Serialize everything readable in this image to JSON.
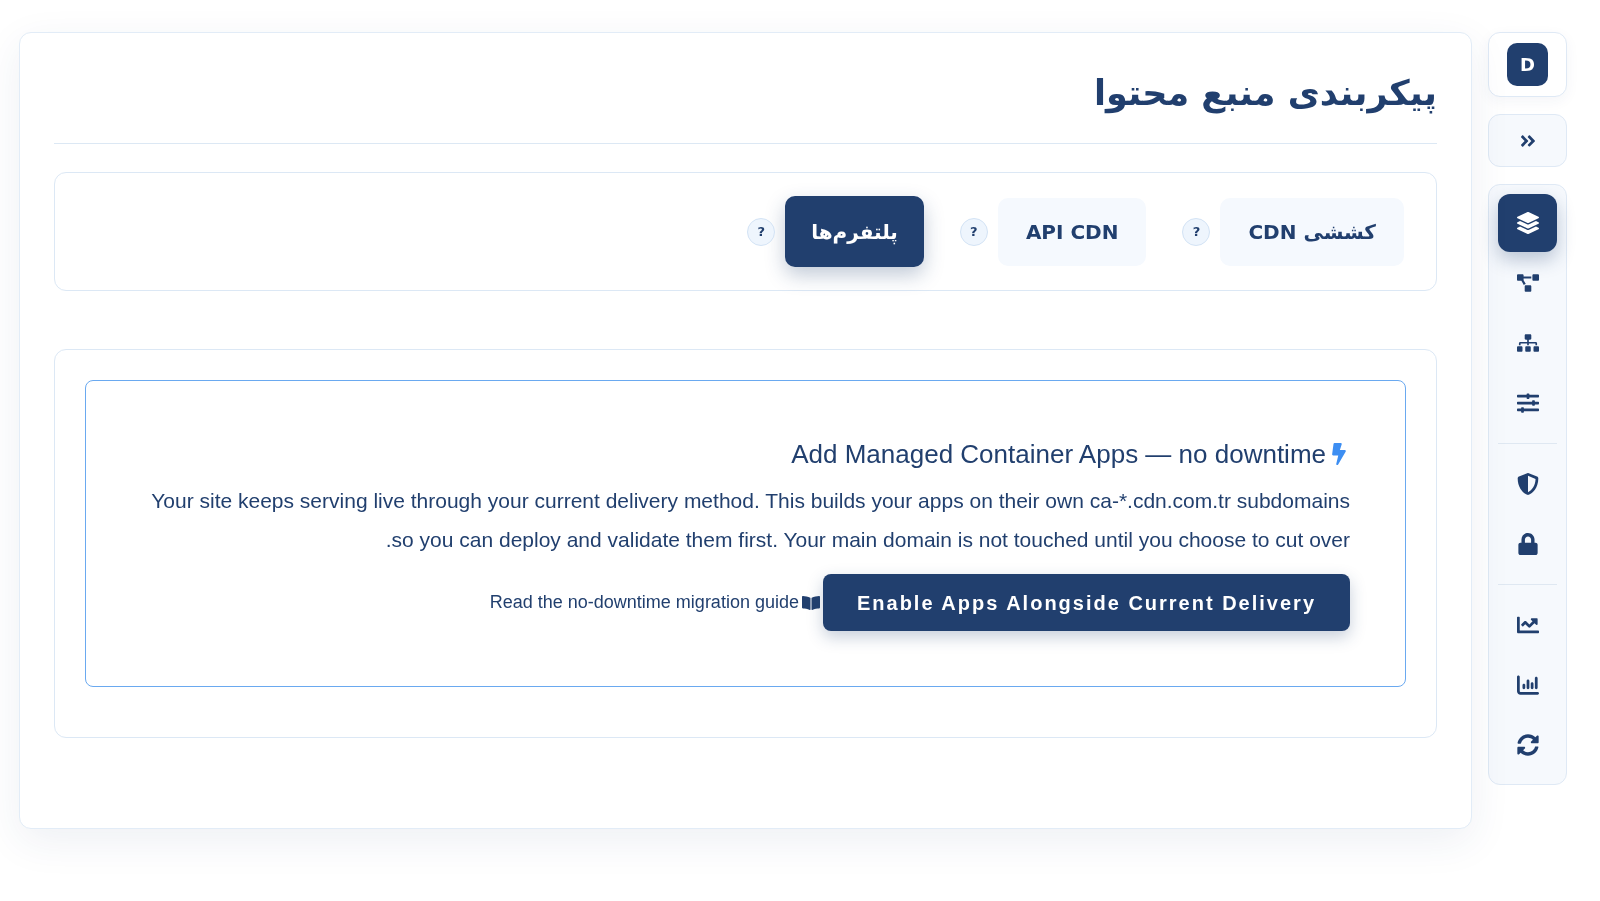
{
  "sidebar": {
    "avatar": "D",
    "groups": [
      {
        "items": [
          {
            "selected": true
          },
          {
            "selected": false
          },
          {
            "selected": false
          },
          {
            "selected": false
          }
        ]
      },
      {
        "items": [
          {
            "selected": false
          },
          {
            "selected": false
          }
        ]
      },
      {
        "items": [
          {
            "selected": false
          },
          {
            "selected": false
          },
          {
            "selected": false
          }
        ]
      }
    ]
  },
  "page": {
    "title": "پیکربندی منبع محتوا"
  },
  "tabs": [
    {
      "label": "کششی CDN",
      "help": "?",
      "selected": false
    },
    {
      "label": "API CDN",
      "help": "?",
      "selected": false
    },
    {
      "label": "پلتفرم‌ها",
      "help": "?",
      "selected": true
    }
  ],
  "panel": {
    "heading": "Add Managed Container Apps — no downtime",
    "body": "Your site keeps serving live through your current delivery method. This builds your apps on their own ca-*.cdn.com.tr subdomains so you can deploy and validate them first. Your main domain is not touched until you choose to cut over.",
    "link": "Read the no-downtime migration guide",
    "button": "Enable Apps Alongside Current Delivery"
  }
}
